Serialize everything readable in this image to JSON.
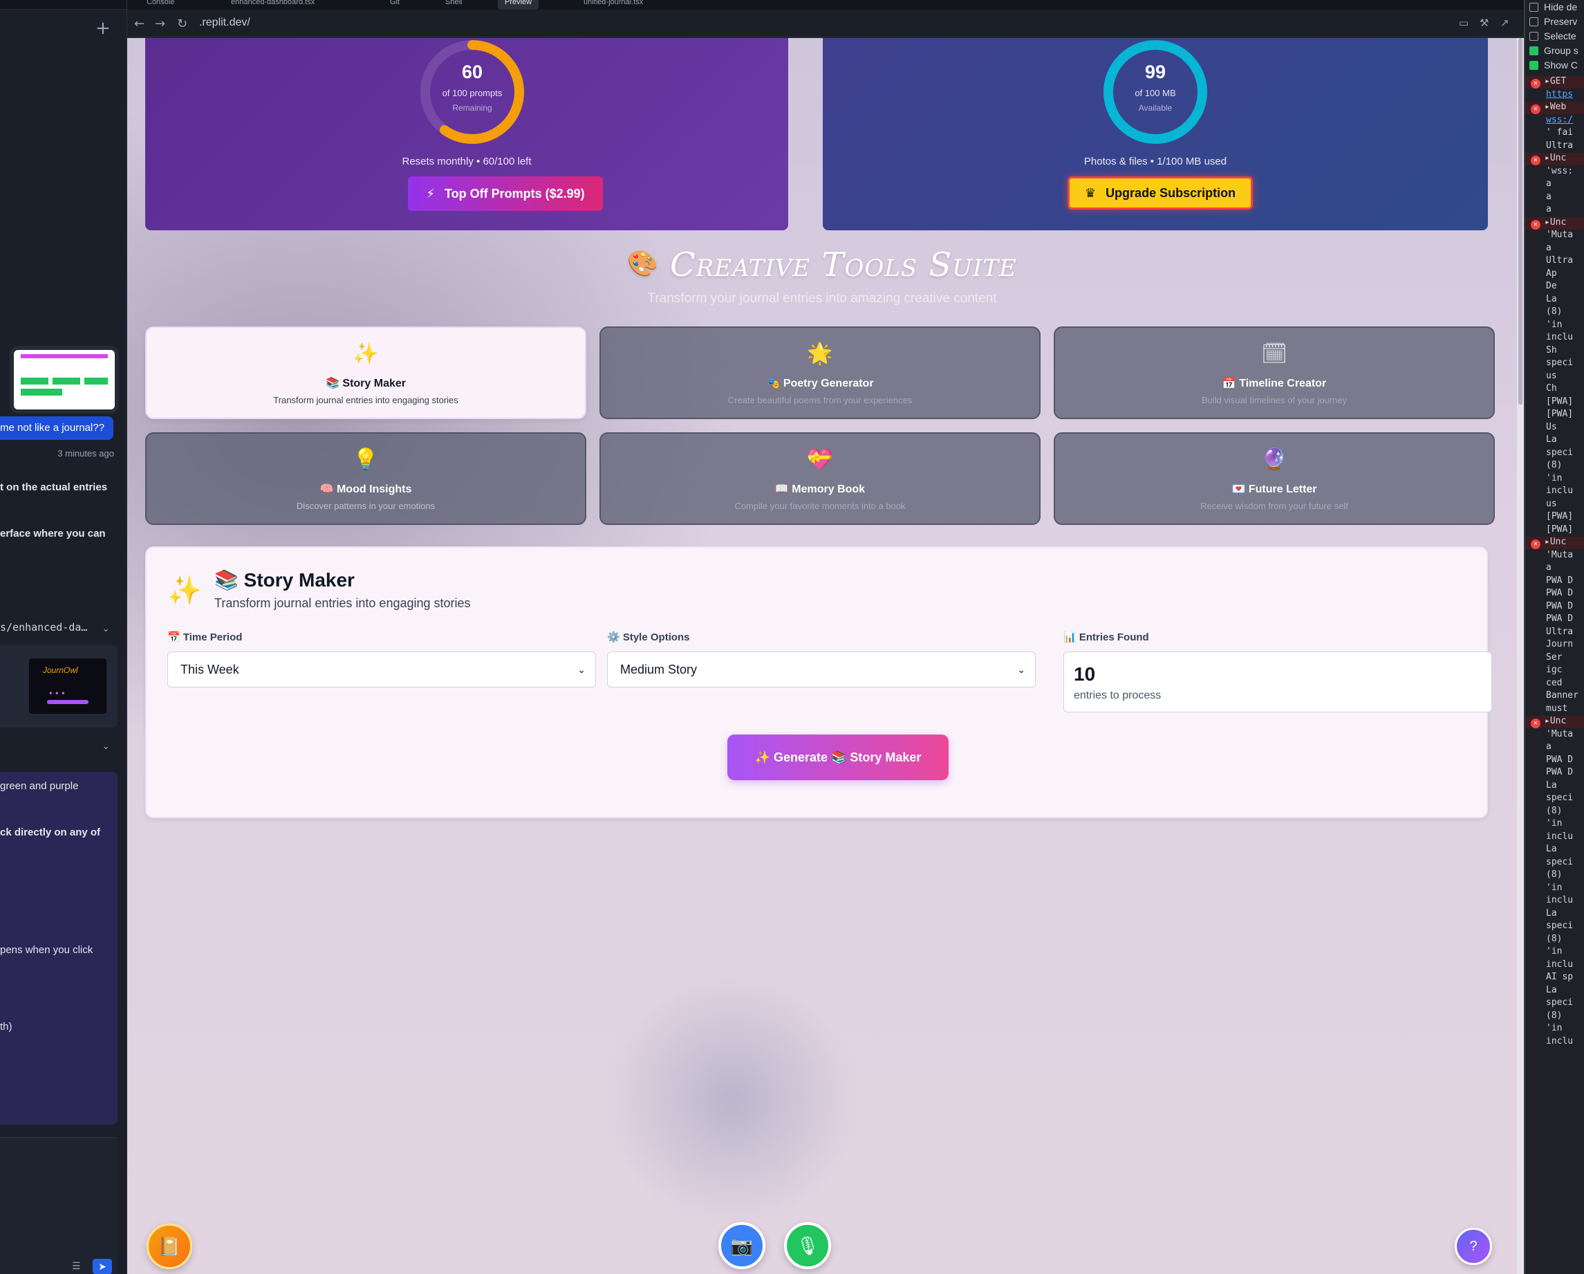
{
  "left_panel": {
    "plus_icon": "+",
    "user_bubble": "me not like a journal??",
    "timestamp": "3 minutes ago",
    "messages": [
      "t on the actual entries",
      "erface where you can",
      "green and purple",
      "ck directly on any of",
      "pens when you click",
      "th)"
    ],
    "file_path": "s/enhanced-da…",
    "thumbnail_title": "JournOwl"
  },
  "browser": {
    "tabs": [
      "Console",
      "enhanced-dashboard.tsx",
      "Git",
      "Shell",
      "Preview",
      "unified-journal.tsx"
    ],
    "active_tab": "Preview",
    "url": ".replit.dev/"
  },
  "usage": {
    "prompts": {
      "value": "60",
      "of": "of 100 prompts",
      "state": "Remaining",
      "fraction": 0.6,
      "note": "Resets monthly • 60/100 left",
      "button": "Top Off Prompts ($2.99)",
      "color": "#f59e0b"
    },
    "storage": {
      "value": "99",
      "of": "of 100 MB",
      "state": "Available",
      "fraction": 0.99,
      "note": "Photos & files • 1/100 MB used",
      "button": "Upgrade Subscription",
      "color": "#06b6d4"
    }
  },
  "suite": {
    "title": "Creative Tools Suite",
    "subtitle": "Transform your journal entries into amazing creative content"
  },
  "tools": [
    {
      "icon": "✨",
      "emoji": "📚",
      "name": "Story Maker",
      "desc": "Transform journal entries into engaging stories"
    },
    {
      "icon": "🌟",
      "emoji": "🎭",
      "name": "Poetry Generator",
      "desc": "Create beautiful poems from your experiences"
    },
    {
      "icon": "🗓",
      "emoji": "📅",
      "name": "Timeline Creator",
      "desc": "Build visual timelines of your journey"
    },
    {
      "icon": "💡",
      "emoji": "🧠",
      "name": "Mood Insights",
      "desc": "Discover patterns in your emotions"
    },
    {
      "icon": "💝",
      "emoji": "📖",
      "name": "Memory Book",
      "desc": "Compile your favorite moments into a book"
    },
    {
      "icon": "🔮",
      "emoji": "💌",
      "name": "Future Letter",
      "desc": "Receive wisdom from your future self"
    }
  ],
  "story_panel": {
    "title": "📚 Story Maker",
    "subtitle": "Transform journal entries into engaging stories",
    "time_label": "📅 Time Period",
    "time_value": "This Week",
    "style_label": "⚙️ Style Options",
    "style_value": "Medium Story",
    "entries_label": "📊 Entries Found",
    "entries_count": "10",
    "entries_note": "entries to process",
    "generate_label": "✨ Generate 📚 Story Maker"
  },
  "devtools": {
    "options": [
      {
        "label": "Hide de",
        "checked": false
      },
      {
        "label": "Preserv",
        "checked": false
      },
      {
        "label": "Selecte",
        "checked": false
      },
      {
        "label": "Group s",
        "checked": true
      },
      {
        "label": "Show C",
        "checked": true
      }
    ],
    "logs": [
      "▸GET",
      "https",
      "▸Web",
      "wss:/",
      "' fai",
      "Ultra",
      "▸Unc",
      "'wss:",
      "a",
      "a",
      "a",
      "▸Unc",
      "'Muta",
      "a",
      "Ultra",
      "Ap",
      "De",
      "La",
      "(8)",
      "'in",
      "inclu",
      "Sh",
      "speci",
      "us",
      "Ch",
      "[PWA]",
      "[PWA]",
      "Us",
      "La",
      "speci",
      "(8)",
      "'in",
      "inclu",
      "us",
      "[PWA]",
      "[PWA]",
      "▸Unc",
      "'Muta",
      "a",
      "PWA D",
      "PWA D",
      "PWA D",
      "PWA D",
      "Ultra",
      "Journ",
      "Ser",
      "igc",
      "ced",
      "Banner",
      "must",
      "▸Unc",
      "'Muta",
      "a",
      "PWA D",
      "PWA D",
      "La",
      "speci",
      "(8)",
      "'in",
      "inclu",
      "La",
      "speci",
      "(8)",
      "'in",
      "inclu",
      "La",
      "speci",
      "(8)",
      "'in",
      "inclu",
      "AI sp",
      "La",
      "speci",
      "(8)",
      "'in",
      "inclu"
    ]
  }
}
